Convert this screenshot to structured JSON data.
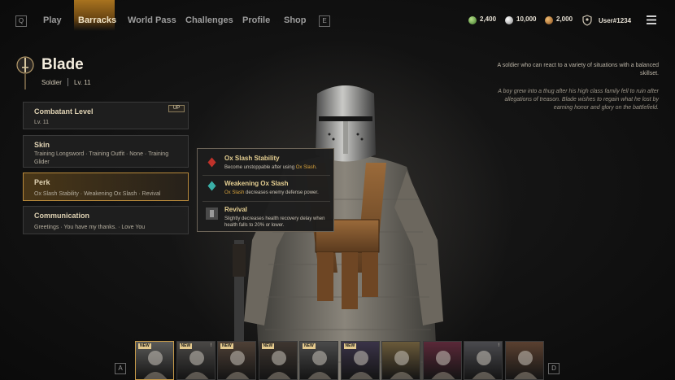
{
  "nav": {
    "left_key": "Q",
    "right_key": "E",
    "tabs": [
      "Play",
      "Barracks",
      "World Pass",
      "Challenges",
      "Profile",
      "Shop"
    ],
    "active_tab": "Barracks"
  },
  "currencies": [
    {
      "icon": "green-gem-icon",
      "value": "2,400",
      "color": "#5fa24a"
    },
    {
      "icon": "silver-coin-icon",
      "value": "10,000",
      "color": "#bfbfbf"
    },
    {
      "icon": "bronze-coin-icon",
      "value": "2,000",
      "color": "#c0803a"
    }
  ],
  "user": {
    "name": "User#1234"
  },
  "character": {
    "name": "Blade",
    "class": "Soldier",
    "level": "Lv. 11"
  },
  "panels": [
    {
      "title": "Combatant Level",
      "subtitle": "Lv. 11",
      "badge": "UP"
    },
    {
      "title": "Skin",
      "subtitle": "Training Longsword · Training Outfit · None · Training Glider"
    },
    {
      "title": "Perk",
      "subtitle": "Ox Slash Stability · Weakening Ox Slash · Revival"
    },
    {
      "title": "Communication",
      "subtitle": "Greetings · You have my thanks. · Love You"
    }
  ],
  "perks": [
    {
      "name": "Ox Slash Stability",
      "desc_pre": "Become unstoppable after using ",
      "desc_hl": "Ox Slash",
      "desc_post": ".",
      "icon_color": "#c0322a"
    },
    {
      "name": "Weakening Ox Slash",
      "desc_pre": "",
      "desc_hl": "Ox Slash",
      "desc_post": " decreases enemy defense power.",
      "icon_color": "#3ab0a8"
    },
    {
      "name": "Revival",
      "desc_pre": "Slightly decreases health recovery delay when health falls to 20% or lower.",
      "desc_hl": "",
      "desc_post": "",
      "icon_color": "#8c8c8c"
    }
  ],
  "lore": {
    "summary": "A soldier who can react to a variety of situations with a balanced skillset.",
    "story": "A boy grew into a thug after his high class family fell to ruin after allegations of treason. Blade wishes to regain what he lost by earning honor and glory on the battlefield."
  },
  "roster": {
    "left_key": "A",
    "right_key": "D",
    "slots": [
      {
        "badge": "NEW",
        "mark": "",
        "selected": true,
        "tint": "#5a5a58"
      },
      {
        "badge": "NEW",
        "mark": "!",
        "tint": "#4a4846"
      },
      {
        "badge": "NEW",
        "mark": "",
        "tint": "#4e4036"
      },
      {
        "badge": "NEW",
        "mark": "",
        "tint": "#3e3630"
      },
      {
        "badge": "NEW",
        "mark": "",
        "tint": "#4a4a4a"
      },
      {
        "badge": "NEW",
        "mark": "",
        "tint": "#3a3348"
      },
      {
        "badge": "",
        "mark": "",
        "tint": "#6a5a3a"
      },
      {
        "badge": "",
        "mark": "",
        "tint": "#5a2838"
      },
      {
        "badge": "",
        "mark": "!",
        "tint": "#4a4a4e"
      },
      {
        "badge": "",
        "mark": "",
        "tint": "#5a4030"
      }
    ]
  }
}
